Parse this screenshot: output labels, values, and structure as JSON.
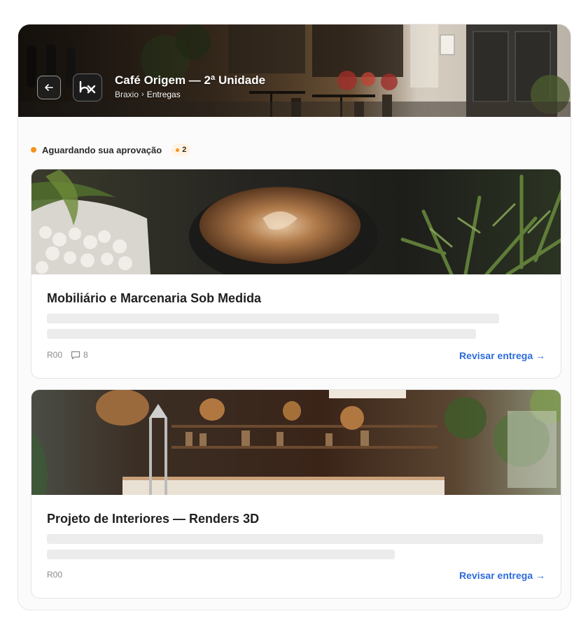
{
  "header": {
    "title": "Café Origem — 2ª Unidade",
    "breadcrumb": [
      "Braxio",
      "Entregas"
    ],
    "logo_text": "bx"
  },
  "section": {
    "title": "Aguardando sua aprovação",
    "count": "2",
    "accent_color": "#f5931d"
  },
  "cards": [
    {
      "title": "Mobiliário e Marcenaria Sob Medida",
      "revision": "R00",
      "comments": "8",
      "action": "Revisar entrega →"
    },
    {
      "title": "Projeto de Interiores — Renders 3D",
      "revision": "R00",
      "action": "Revisar entrega →"
    }
  ],
  "colors": {
    "link": "#2d6bdc",
    "badge_bg": "#fff4e5"
  },
  "icons": [
    "arrow-left-icon",
    "comment-icon"
  ]
}
